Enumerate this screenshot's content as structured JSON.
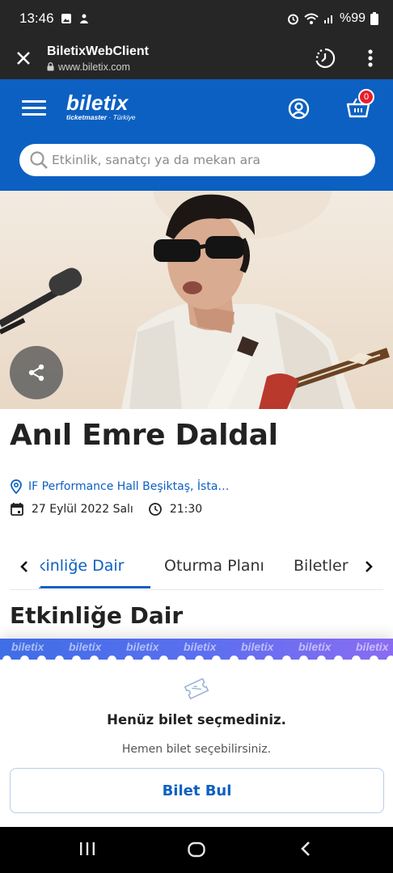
{
  "status_bar": {
    "time": "13:46",
    "battery": "%99"
  },
  "browser": {
    "title": "BiletixWebClient",
    "url": "www.biletix.com"
  },
  "header": {
    "brand": "biletix",
    "brand_sub_bold": "ticketmaster",
    "brand_sub": "Türkiye",
    "cart_count": "0",
    "search_placeholder": "Etkinlik, sanatçı ya da mekan ara",
    "colors": {
      "primary": "#0c60c2",
      "badge": "#e81e2a"
    }
  },
  "event": {
    "title": "Anıl Emre Daldal",
    "venue": "IF Performance Hall Beşiktaş, İsta…",
    "date": "27 Eylül 2022 Salı",
    "time": "21:30"
  },
  "tabs": {
    "items": [
      "Etkinliğe Dair",
      "Oturma Planı",
      "Biletler"
    ],
    "active": "Etkinliğe Dair"
  },
  "section": {
    "title": "Etkinliğe Dair"
  },
  "ticket_panel": {
    "strip_word": "biletix",
    "empty_title": "Henüz bilet seçmediniz.",
    "empty_subtitle": "Hemen bilet seçebilirsiniz.",
    "button_label": "Bilet Bul"
  },
  "icons": [
    "alarm-icon",
    "wifi-icon",
    "signal-icon",
    "battery-icon",
    "close-icon",
    "lock-icon",
    "history-icon",
    "more-vert-icon",
    "menu-icon",
    "user-icon",
    "cart-icon",
    "search-icon",
    "share-icon",
    "location-pin-icon",
    "calendar-icon",
    "clock-icon",
    "chevron-left-icon",
    "chevron-right-icon",
    "ticket-icon",
    "recents-icon",
    "home-icon",
    "back-icon"
  ]
}
